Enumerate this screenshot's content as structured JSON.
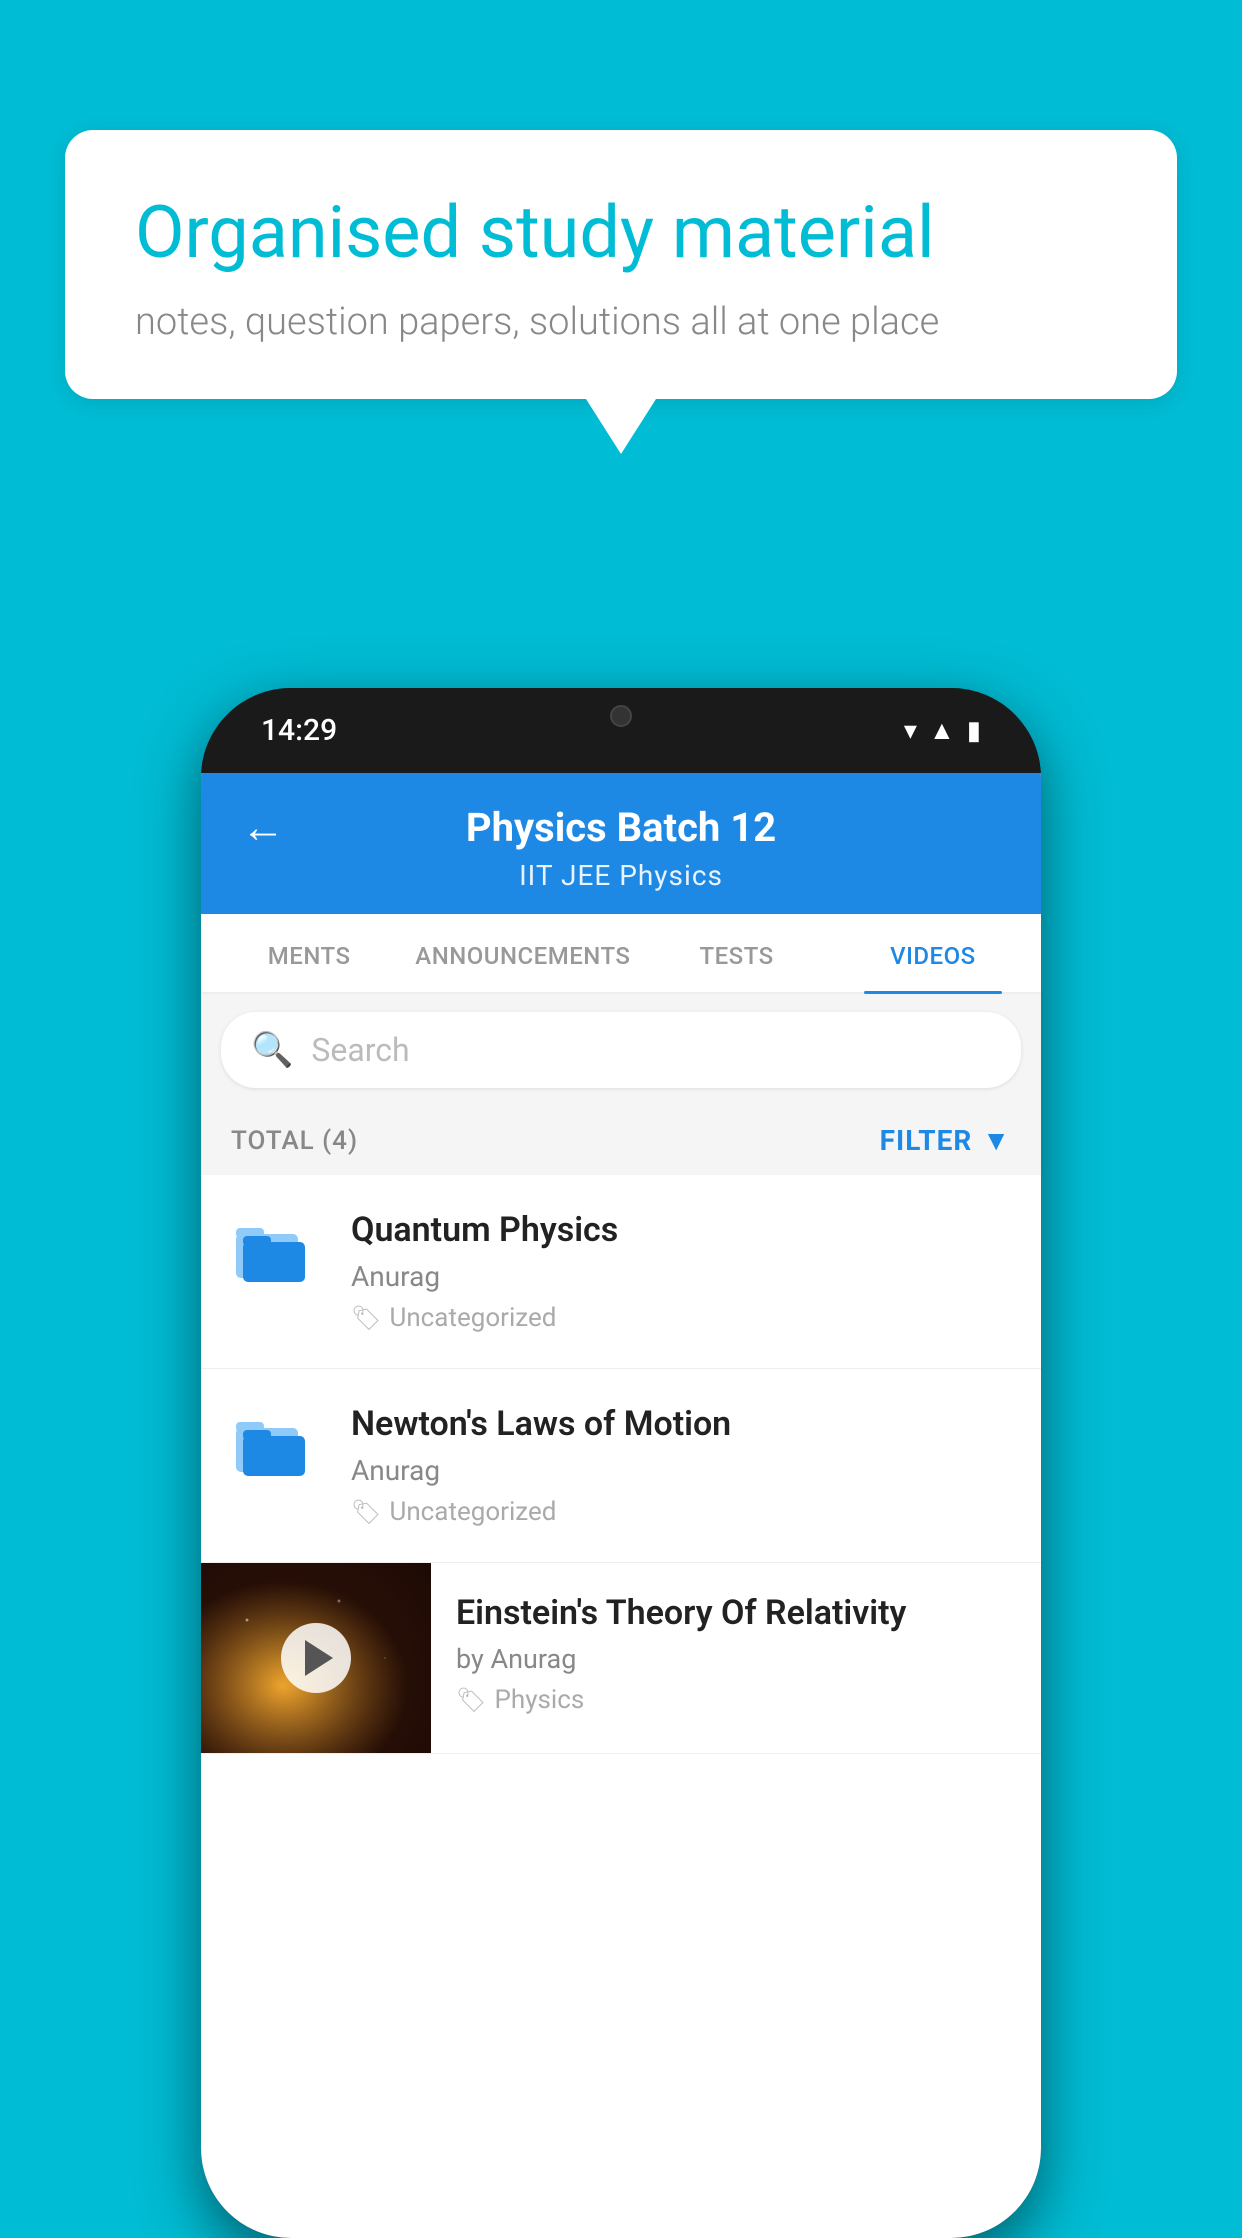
{
  "background_color": "#00BCD4",
  "speech_bubble": {
    "title": "Organised study material",
    "subtitle": "notes, question papers, solutions all at one place"
  },
  "phone": {
    "status_bar": {
      "time": "14:29"
    },
    "header": {
      "back_label": "←",
      "title": "Physics Batch 12",
      "subtitle_tags": "IIT JEE    Physics"
    },
    "tabs": [
      {
        "label": "MENTS",
        "active": false
      },
      {
        "label": "ANNOUNCEMENTS",
        "active": false
      },
      {
        "label": "TESTS",
        "active": false
      },
      {
        "label": "VIDEOS",
        "active": true
      }
    ],
    "search": {
      "placeholder": "Search"
    },
    "filter": {
      "total_label": "TOTAL (4)",
      "filter_label": "FILTER"
    },
    "videos": [
      {
        "id": "1",
        "title": "Quantum Physics",
        "author": "Anurag",
        "tag": "Uncategorized",
        "has_thumbnail": false
      },
      {
        "id": "2",
        "title": "Newton's Laws of Motion",
        "author": "Anurag",
        "tag": "Uncategorized",
        "has_thumbnail": false
      },
      {
        "id": "3",
        "title": "Einstein's Theory Of Relativity",
        "author": "by Anurag",
        "tag": "Physics",
        "has_thumbnail": true
      }
    ]
  }
}
